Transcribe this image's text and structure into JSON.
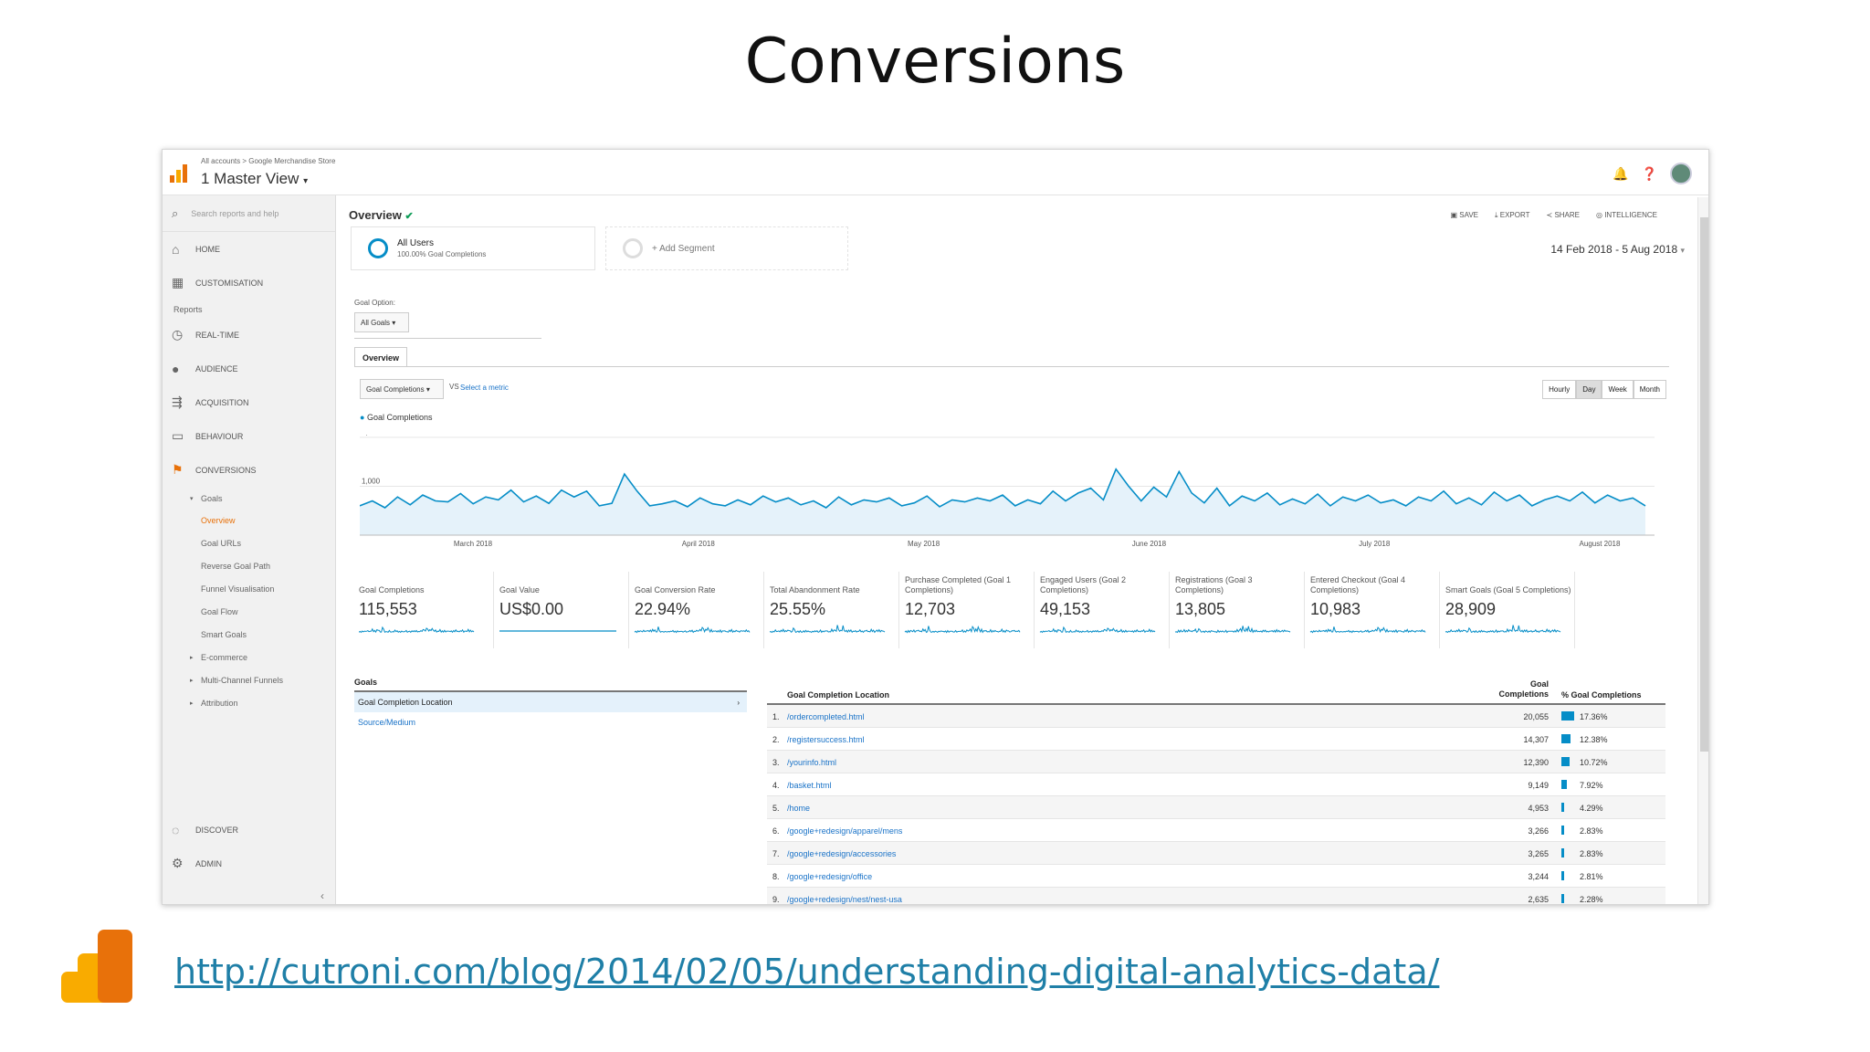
{
  "slide": {
    "title": "Conversions",
    "link": "http://cutroni.com/blog/2014/02/05/understanding-digital-analytics-data/"
  },
  "header": {
    "breadcrumb": "All accounts > Google Merchandise Store",
    "view": "1 Master View"
  },
  "sidebar": {
    "search_placeholder": "Search reports and help",
    "home": "HOME",
    "customisation": "CUSTOMISATION",
    "reports_label": "Reports",
    "realtime": "REAL-TIME",
    "audience": "AUDIENCE",
    "acquisition": "ACQUISITION",
    "behaviour": "BEHAVIOUR",
    "conversions": "CONVERSIONS",
    "goals": "Goals",
    "sub": [
      "Overview",
      "Goal URLs",
      "Reverse Goal Path",
      "Funnel Visualisation",
      "Goal Flow",
      "Smart Goals"
    ],
    "ecommerce": "E-commerce",
    "multichannel": "Multi-Channel Funnels",
    "attribution": "Attribution",
    "discover": "DISCOVER",
    "admin": "ADMIN"
  },
  "page": {
    "title": "Overview",
    "actions": [
      "SAVE",
      "EXPORT",
      "SHARE",
      "INTELLIGENCE"
    ],
    "segment1": {
      "name": "All Users",
      "sub": "100.00% Goal Completions"
    },
    "segment2": "+ Add Segment",
    "date_range": "14 Feb 2018 - 5 Aug 2018",
    "goal_option_label": "Goal Option:",
    "goal_option_value": "All Goals",
    "tab": "Overview",
    "metric_select": "Goal Completions",
    "vs": "VS",
    "select_metric": "Select a metric",
    "granularity": [
      "Hourly",
      "Day",
      "Week",
      "Month"
    ],
    "legend": "Goal Completions"
  },
  "chart_data": {
    "type": "area",
    "series": [
      {
        "name": "Goal Completions",
        "values": [
          600,
          700,
          560,
          780,
          620,
          820,
          700,
          680,
          850,
          640,
          780,
          720,
          920,
          680,
          800,
          650,
          920,
          780,
          900,
          600,
          650,
          1250,
          900,
          600,
          640,
          700,
          580,
          760,
          640,
          600,
          720,
          620,
          800,
          680,
          760,
          620,
          700,
          560,
          780,
          620,
          720,
          680,
          760,
          600,
          660,
          800,
          580,
          720,
          680,
          760,
          700,
          820,
          600,
          720,
          640,
          900,
          700,
          860,
          960,
          720,
          1350,
          1000,
          700,
          980,
          780,
          1300,
          860,
          660,
          960,
          600,
          800,
          700,
          860,
          620,
          740,
          640,
          840,
          600,
          780,
          700,
          820,
          660,
          720,
          600,
          780,
          700,
          900,
          640,
          760,
          620,
          880,
          700,
          820,
          600,
          720,
          800,
          700,
          880,
          660,
          820,
          700,
          760,
          600
        ]
      }
    ],
    "x_tick_labels": [
      "March 2018",
      "April 2018",
      "May 2018",
      "June 2018",
      "July 2018",
      "August 2018"
    ],
    "y_tick_labels": [
      "2,000",
      "1,000"
    ],
    "ylim": [
      0,
      2000
    ]
  },
  "metrics": [
    {
      "label": "Goal Completions",
      "value": "115,553"
    },
    {
      "label": "Goal Value",
      "value": "US$0.00"
    },
    {
      "label": "Goal Conversion Rate",
      "value": "22.94%"
    },
    {
      "label": "Total Abandonment Rate",
      "value": "25.55%"
    },
    {
      "label": "Purchase Completed (Goal 1 Completions)",
      "value": "12,703"
    },
    {
      "label": "Engaged Users (Goal 2 Completions)",
      "value": "49,153"
    },
    {
      "label": "Registrations (Goal 3 Completions)",
      "value": "13,805"
    },
    {
      "label": "Entered Checkout (Goal 4 Completions)",
      "value": "10,983"
    },
    {
      "label": "Smart Goals (Goal 5 Completions)",
      "value": "28,909"
    }
  ],
  "goals_panel": {
    "header": "Goals",
    "rows": [
      "Goal Completion Location",
      "Source/Medium"
    ]
  },
  "table": {
    "headers": [
      "Goal Completion Location",
      "Goal Completions",
      "% Goal Completions"
    ],
    "rows": [
      {
        "n": "1.",
        "path": "/ordercompleted.html",
        "value": "20,055",
        "pct": "17.36%",
        "share": 17.36
      },
      {
        "n": "2.",
        "path": "/registersuccess.html",
        "value": "14,307",
        "pct": "12.38%",
        "share": 12.38
      },
      {
        "n": "3.",
        "path": "/yourinfo.html",
        "value": "12,390",
        "pct": "10.72%",
        "share": 10.72
      },
      {
        "n": "4.",
        "path": "/basket.html",
        "value": "9,149",
        "pct": "7.92%",
        "share": 7.92
      },
      {
        "n": "5.",
        "path": "/home",
        "value": "4,953",
        "pct": "4.29%",
        "share": 4.29
      },
      {
        "n": "6.",
        "path": "/google+redesign/apparel/mens",
        "value": "3,266",
        "pct": "2.83%",
        "share": 2.83
      },
      {
        "n": "7.",
        "path": "/google+redesign/accessories",
        "value": "3,265",
        "pct": "2.83%",
        "share": 2.83
      },
      {
        "n": "8.",
        "path": "/google+redesign/office",
        "value": "3,244",
        "pct": "2.81%",
        "share": 2.81
      },
      {
        "n": "9.",
        "path": "/google+redesign/nest/nest-usa",
        "value": "2,635",
        "pct": "2.28%",
        "share": 2.28
      }
    ]
  }
}
